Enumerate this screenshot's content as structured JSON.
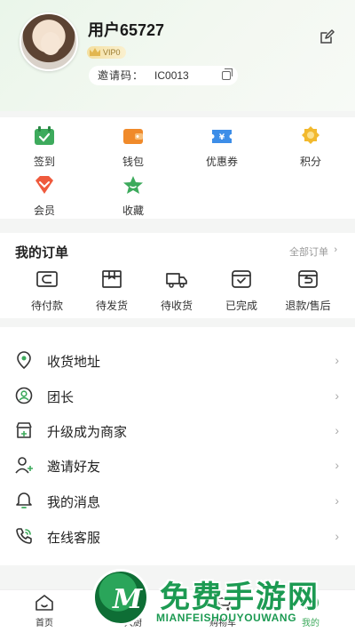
{
  "profile": {
    "username": "用户65727",
    "vip_label": "VIP0",
    "invite_label": "邀请码：",
    "invite_code": "IC0013"
  },
  "quick_actions": [
    {
      "label": "签到",
      "icon": "calendar-check-icon",
      "color": "#3daa5c"
    },
    {
      "label": "钱包",
      "icon": "wallet-icon",
      "color": "#f08a2a"
    },
    {
      "label": "优惠券",
      "icon": "coupon-icon",
      "color": "#3d8ee8"
    },
    {
      "label": "积分",
      "icon": "points-badge-icon",
      "color": "#f2b92e"
    },
    {
      "label": "会员",
      "icon": "member-diamond-icon",
      "color": "#ef5a3d"
    },
    {
      "label": "收藏",
      "icon": "star-icon",
      "color": "#3daa5c"
    }
  ],
  "orders": {
    "title": "我的订单",
    "view_all": "全部订单",
    "statuses": [
      {
        "label": "待付款",
        "icon": "card-icon"
      },
      {
        "label": "待发货",
        "icon": "box-icon"
      },
      {
        "label": "待收货",
        "icon": "truck-icon"
      },
      {
        "label": "已完成",
        "icon": "check-box-icon"
      },
      {
        "label": "退款/售后",
        "icon": "refund-icon"
      }
    ]
  },
  "menu": [
    {
      "label": "收货地址",
      "icon": "location-pin-icon"
    },
    {
      "label": "团长",
      "icon": "user-circle-icon"
    },
    {
      "label": "升级成为商家",
      "icon": "store-upgrade-icon"
    },
    {
      "label": "邀请好友",
      "icon": "add-user-icon"
    },
    {
      "label": "我的消息",
      "icon": "bell-icon"
    },
    {
      "label": "在线客服",
      "icon": "phone-icon"
    }
  ],
  "tabbar": [
    {
      "label": "首页",
      "icon": "home-icon"
    },
    {
      "label": "大厨",
      "icon": "chef-icon"
    },
    {
      "label": "购物车",
      "icon": "cart-icon"
    },
    {
      "label": "我的",
      "icon": "profile-icon"
    }
  ],
  "watermark": {
    "logo_letter": "M",
    "title": "免费手游网",
    "subtitle": "MIANFEISHOUYOUWANG"
  },
  "colors": {
    "brand_green": "#3daa5c",
    "header_bg": "#eaf6ea",
    "watermark_green": "#1c9a52"
  }
}
